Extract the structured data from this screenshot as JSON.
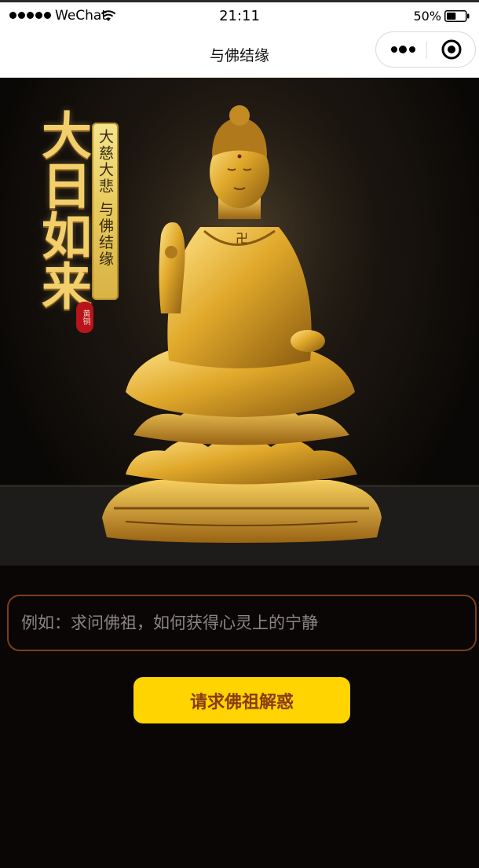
{
  "status_bar": {
    "carrier": "WeChat",
    "time": "21:11",
    "battery_percent": "50%",
    "battery_level": 0.5,
    "signal_bars": 5
  },
  "nav": {
    "title": "与佛结缘",
    "more_icon": "more-dots-icon",
    "close_icon": "target-circle-icon"
  },
  "hero": {
    "title": "大日如来",
    "scroll_text": "大慈大悲 与佛结缘",
    "seal_text": "黄铜",
    "image": "golden-buddha-statue"
  },
  "question": {
    "value": "",
    "placeholder": "例如：求问佛祖，如何获得心灵上的宁静"
  },
  "ask_button": {
    "label": "请求佛祖解惑"
  },
  "colors": {
    "background": "#0a0605",
    "input_border": "#7a3f1c",
    "button_bg": "#ffd400",
    "button_text": "#8a3a10",
    "gold": "#e8b93a"
  }
}
